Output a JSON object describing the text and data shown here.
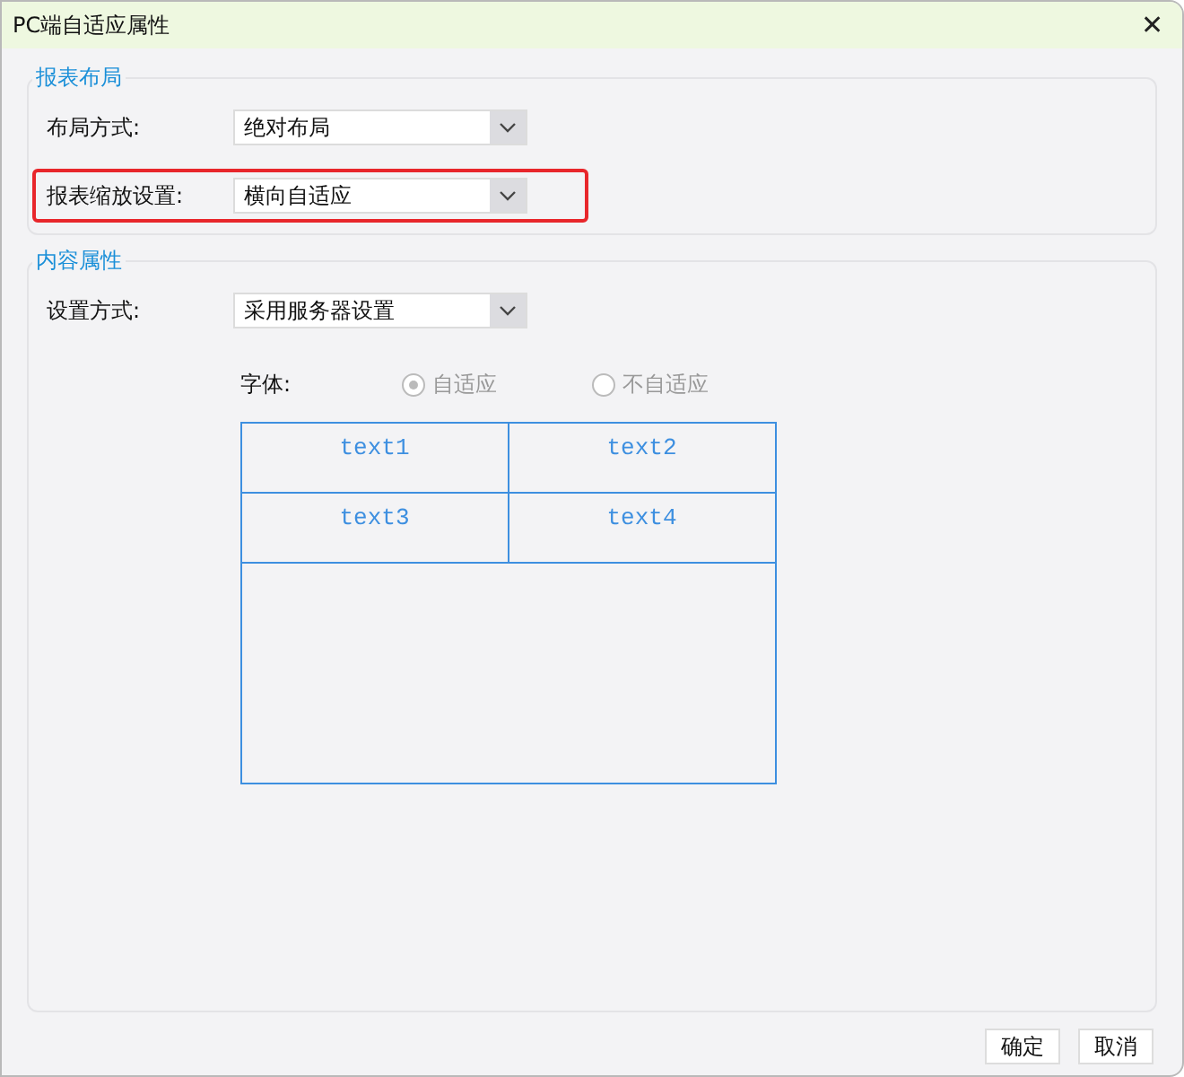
{
  "window": {
    "title": "PC端自适应属性",
    "close": "✕"
  },
  "sections": [
    {
      "title": "报表布局",
      "fields": [
        {
          "label": "布局方式:",
          "value": "绝对布局",
          "highlighted": false
        },
        {
          "label": "报表缩放设置:",
          "value": "横向自适应",
          "highlighted": true
        }
      ]
    },
    {
      "title": "内容属性",
      "fields": [
        {
          "label": "设置方式:",
          "value": "采用服务器设置",
          "highlighted": false
        }
      ],
      "font_option": {
        "label": "字体:",
        "disabled": true,
        "options": [
          {
            "label": "自适应",
            "selected": true
          },
          {
            "label": "不自适应",
            "selected": false
          }
        ]
      },
      "preview": {
        "cells": [
          "text1",
          "text2",
          "text3",
          "text4"
        ]
      }
    }
  ],
  "buttons": [
    "确定",
    "取消"
  ]
}
